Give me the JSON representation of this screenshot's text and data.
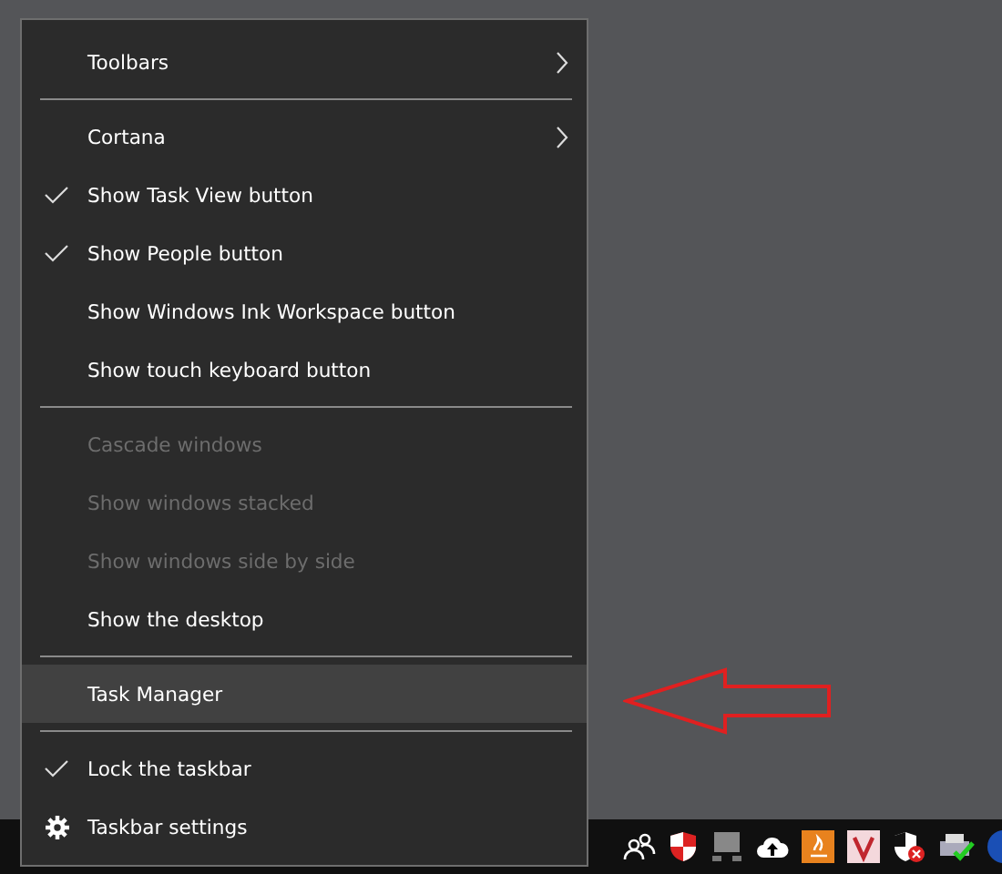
{
  "context_menu": {
    "items": [
      {
        "kind": "item",
        "label": "Toolbars",
        "checked": false,
        "disabled": false,
        "submenu": true,
        "selected": false
      },
      {
        "kind": "separator"
      },
      {
        "kind": "item",
        "label": "Cortana",
        "checked": false,
        "disabled": false,
        "submenu": true,
        "selected": false
      },
      {
        "kind": "item",
        "label": "Show Task View button",
        "checked": true,
        "disabled": false,
        "submenu": false,
        "selected": false
      },
      {
        "kind": "item",
        "label": "Show People button",
        "checked": true,
        "disabled": false,
        "submenu": false,
        "selected": false
      },
      {
        "kind": "item",
        "label": "Show Windows Ink Workspace button",
        "checked": false,
        "disabled": false,
        "submenu": false,
        "selected": false
      },
      {
        "kind": "item",
        "label": "Show touch keyboard button",
        "checked": false,
        "disabled": false,
        "submenu": false,
        "selected": false
      },
      {
        "kind": "separator"
      },
      {
        "kind": "item",
        "label": "Cascade windows",
        "checked": false,
        "disabled": true,
        "submenu": false,
        "selected": false
      },
      {
        "kind": "item",
        "label": "Show windows stacked",
        "checked": false,
        "disabled": true,
        "submenu": false,
        "selected": false
      },
      {
        "kind": "item",
        "label": "Show windows side by side",
        "checked": false,
        "disabled": true,
        "submenu": false,
        "selected": false
      },
      {
        "kind": "item",
        "label": "Show the desktop",
        "checked": false,
        "disabled": false,
        "submenu": false,
        "selected": false
      },
      {
        "kind": "separator"
      },
      {
        "kind": "item",
        "label": "Task Manager",
        "checked": false,
        "disabled": false,
        "submenu": false,
        "selected": true
      },
      {
        "kind": "separator"
      },
      {
        "kind": "item",
        "label": "Lock the taskbar",
        "checked": true,
        "disabled": false,
        "submenu": false,
        "selected": false
      },
      {
        "kind": "settings",
        "label": "Taskbar settings",
        "checked": false,
        "disabled": false,
        "submenu": false,
        "selected": false
      }
    ]
  }
}
